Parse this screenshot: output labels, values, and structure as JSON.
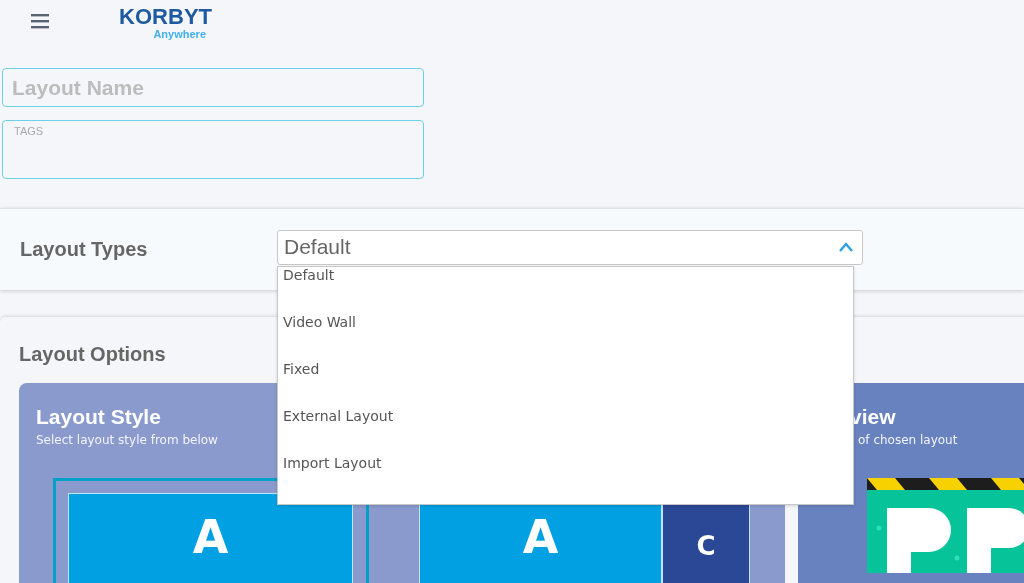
{
  "header": {
    "logo": "KORBYT",
    "logo_subtitle": "Anywhere"
  },
  "layout_name": {
    "placeholder": "Layout Name"
  },
  "tags": {
    "placeholder": "TAGS"
  },
  "layout_types": {
    "label": "Layout Types",
    "value": "Default",
    "expanded": true,
    "options": [
      {
        "label": "Default"
      },
      {
        "label": "Video Wall"
      },
      {
        "label": "Fixed"
      },
      {
        "label": "External Layout"
      },
      {
        "label": "Import Layout"
      }
    ]
  },
  "layout_options": {
    "title": "Layout Options",
    "style_card": {
      "title": "Layout Style",
      "subtitle": "Select layout style from below",
      "thumbnails": [
        {
          "kind": "single",
          "selected": true,
          "zones": [
            "A"
          ]
        },
        {
          "kind": "split",
          "selected": false,
          "zones": [
            "A",
            "C"
          ]
        }
      ]
    },
    "preview_card": {
      "title": "view",
      "subtitle": "of chosen layout"
    }
  }
}
